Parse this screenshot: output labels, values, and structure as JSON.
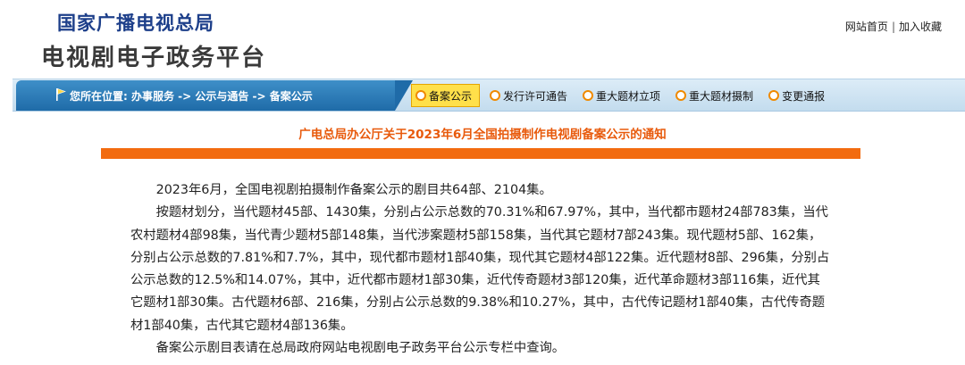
{
  "header": {
    "org_name": "国家广播电视总局",
    "platform_name": "电视剧电子政务平台",
    "links": [
      "网站首页",
      "加入收藏"
    ],
    "link_separator": "|"
  },
  "navbar": {
    "location_text": "您所在位置: 办事服务 -> 公示与通告 -> 备案公示",
    "tabs": [
      {
        "label": "备案公示",
        "active": true
      },
      {
        "label": "发行许可通告",
        "active": false
      },
      {
        "label": "重大题材立项",
        "active": false
      },
      {
        "label": "重大题材摄制",
        "active": false
      },
      {
        "label": "变更通报",
        "active": false
      }
    ],
    "icon_names": {
      "location": "flag-icon",
      "tab": "circle-bullet-icon"
    }
  },
  "notice": {
    "title": "广电总局办公厅关于2023年6月全国拍摄制作电视剧备案公示的通知",
    "paragraphs": [
      "2023年6月，全国电视剧拍摄制作备案公示的剧目共64部、2104集。",
      "按题材划分，当代题材45部、1430集，分别占公示总数的70.31%和67.97%，其中，当代都市题材24部783集，当代农村题材4部98集，当代青少题材5部148集，当代涉案题材5部158集，当代其它题材7部243集。现代题材5部、162集，分别占公示总数的7.81%和7.7%，其中，现代都市题材1部40集，现代其它题材4部122集。近代题材8部、296集，分别占公示总数的12.5%和14.07%，其中，近代都市题材1部30集，近代传奇题材3部120集，近代革命题材3部116集，近代其它题材1部30集。古代题材6部、216集，分别占公示总数的9.38%和10.27%，其中，古代传记题材1部40集，古代传奇题材1部40集，古代其它题材4部136集。",
      "备案公示剧目表请在总局政府网站电视剧电子政务平台公示专栏中查询。"
    ]
  },
  "colors": {
    "org_blue": "#1d3f8a",
    "nav_blue": "#1f6ba8",
    "title_orange": "#e85a0c",
    "bar_orange": "#f26b0f",
    "tab_active_bg": "#ffe04a",
    "tab_icon_orange": "#f08a00"
  }
}
